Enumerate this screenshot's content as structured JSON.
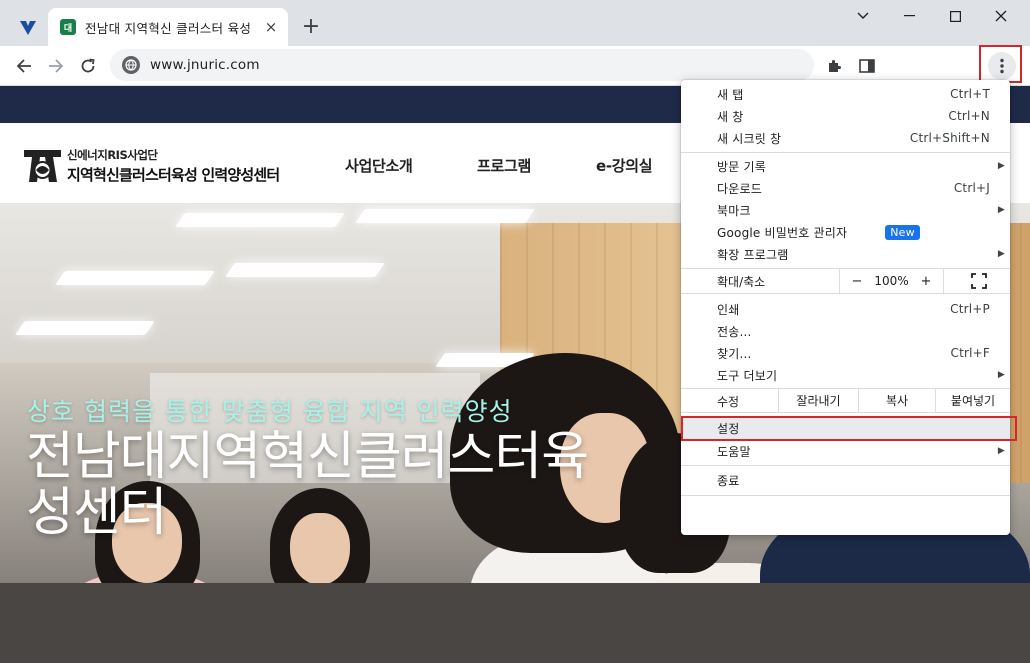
{
  "browser": {
    "tab": {
      "favicon_text": "대",
      "title": "전남대 지역혁신 클러스터 육성",
      "close": "×"
    },
    "new_tab": "+",
    "url": "www.jnuric.com"
  },
  "site": {
    "logo": {
      "line1": "신에너지RIS사업단",
      "line2": "지역혁신클러스터육성 인력양성센터"
    },
    "nav": [
      "사업단소개",
      "프로그램",
      "e-강의실"
    ],
    "hero": {
      "subtitle": "상호 협력을 통한 맞춤형 융합 지역 인력양성",
      "title_line1": "전남대지역혁신클러스터육",
      "title_line2": "성센터"
    }
  },
  "menu": {
    "new_tab": {
      "label": "새 탭",
      "shortcut": "Ctrl+T"
    },
    "new_window": {
      "label": "새 창",
      "shortcut": "Ctrl+N"
    },
    "incognito": {
      "label": "새 시크릿 창",
      "shortcut": "Ctrl+Shift+N"
    },
    "history": {
      "label": "방문 기록"
    },
    "downloads": {
      "label": "다운로드",
      "shortcut": "Ctrl+J"
    },
    "bookmarks": {
      "label": "북마크"
    },
    "password_manager": {
      "label": "Google 비밀번호 관리자",
      "badge": "New"
    },
    "extensions": {
      "label": "확장 프로그램"
    },
    "zoom": {
      "label": "확대/축소",
      "minus": "−",
      "value": "100%",
      "plus": "+"
    },
    "print": {
      "label": "인쇄",
      "shortcut": "Ctrl+P"
    },
    "cast": {
      "label": "전송..."
    },
    "find": {
      "label": "찾기...",
      "shortcut": "Ctrl+F"
    },
    "more_tools": {
      "label": "도구 더보기"
    },
    "edit": {
      "label": "수정",
      "cut": "잘라내기",
      "copy": "복사",
      "paste": "붙여넣기"
    },
    "settings": {
      "label": "설정"
    },
    "help": {
      "label": "도움말"
    },
    "exit": {
      "label": "종료"
    }
  },
  "colors": {
    "highlight": "#d5262c",
    "accent_blue": "#1a73e8",
    "site_topbar": "#1e2a48",
    "hero_subtitle": "#a7f2e8"
  }
}
